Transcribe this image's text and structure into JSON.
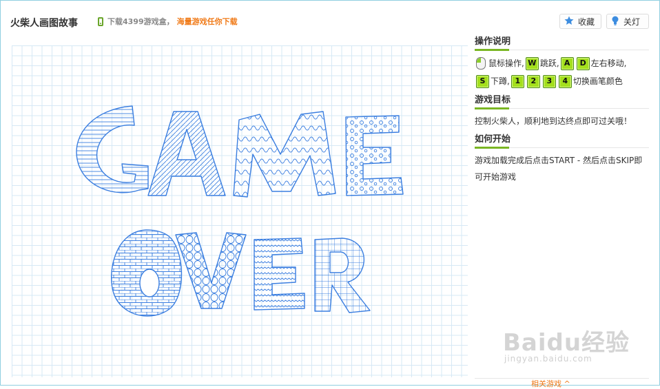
{
  "header": {
    "title": "火柴人画图故事",
    "promo_part1": "下载4399游戏盒，",
    "promo_part2": "海量游戏任你下载",
    "fav_label": "收藏",
    "light_label": "关灯"
  },
  "game": {
    "line1": "GAME",
    "line2": "OVER",
    "ink_color": "#3a7ee0"
  },
  "sidebar": {
    "instructions": {
      "title": "操作说明",
      "mouse_text": "鼠标操作,",
      "jump_text": "跳跃,",
      "move_text": "左右移动,",
      "down_text": "下蹲,",
      "color_text": "切换画笔颜色",
      "keys": {
        "w": "W",
        "a": "A",
        "d": "D",
        "s": "S",
        "k1": "1",
        "k2": "2",
        "k3": "3",
        "k4": "4"
      }
    },
    "goal": {
      "title": "游戏目标",
      "text": "控制火柴人，顺利地到达终点即可过关哦！"
    },
    "start": {
      "title": "如何开始",
      "text": "游戏加载完成后点击START - 然后点击SKIP即可开始游戏"
    },
    "related": "相关游戏 ^"
  },
  "watermark": {
    "brand": "Baidu经验",
    "url": "jingyan.baidu.com"
  }
}
